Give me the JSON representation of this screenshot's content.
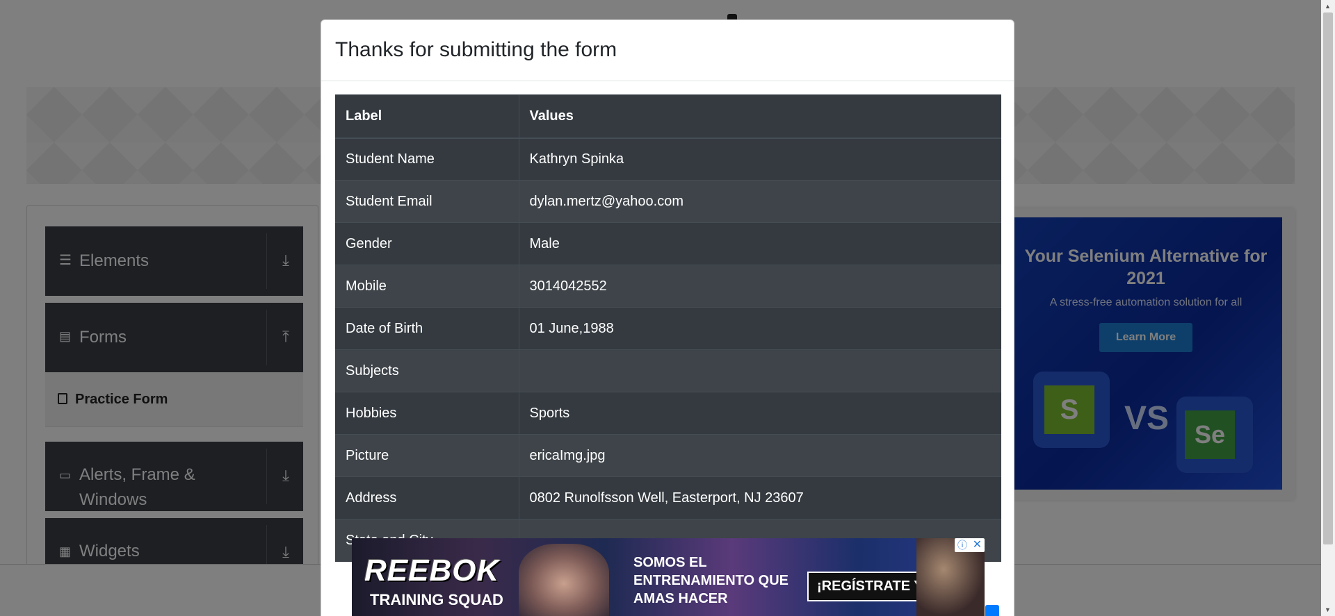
{
  "modal": {
    "title": "Thanks for submitting the form",
    "table": {
      "headers": [
        "Label",
        "Values"
      ],
      "rows": [
        {
          "label": "Student Name",
          "value": "Kathryn Spinka"
        },
        {
          "label": "Student Email",
          "value": "dylan.mertz@yahoo.com"
        },
        {
          "label": "Gender",
          "value": "Male"
        },
        {
          "label": "Mobile",
          "value": "3014042552"
        },
        {
          "label": "Date of Birth",
          "value": "01 June,1988"
        },
        {
          "label": "Subjects",
          "value": ""
        },
        {
          "label": "Hobbies",
          "value": "Sports"
        },
        {
          "label": "Picture",
          "value": "ericaImg.jpg"
        },
        {
          "label": "Address",
          "value": "0802 Runolfsson Well, Easterport, NJ 23607"
        },
        {
          "label": "State and City",
          "value": ""
        }
      ]
    }
  },
  "sidebar": {
    "groups": [
      {
        "label": "Elements",
        "icon": "hamburger-icon",
        "arrow": "download-icon"
      },
      {
        "label": "Forms",
        "icon": "document-icon",
        "arrow": "upload-icon"
      },
      {
        "label": "Alerts, Frame & Windows",
        "icon": "window-icon",
        "arrow": "download-icon"
      },
      {
        "label": "Widgets",
        "icon": "widgets-icon",
        "arrow": "download-icon"
      }
    ],
    "active_item": "Practice Form"
  },
  "ad_right": {
    "title": "Your Selenium Alternative for 2021",
    "subtitle": "A stress-free automation solution for all",
    "button": "Learn More",
    "vs": "VS",
    "k_logo": "S",
    "se_logo": "Se"
  },
  "ad_bottom": {
    "brand": "REEBOK",
    "brand_sub": "TRAINING SQUAD",
    "tagline_1": "SOMOS EL",
    "tagline_2": "ENTRENAMIENTO QUE",
    "tagline_3": "AMAS HACER",
    "cta": "¡REGÍSTRATE YA!",
    "info_glyph": "ⓘ",
    "close_glyph": "✕"
  },
  "colors": {
    "overlay": "rgba(0,0,0,0.5)",
    "table_dark": "#343a40",
    "sidebar_group": "#3a3f47",
    "ad_blue": "#1340b8"
  }
}
